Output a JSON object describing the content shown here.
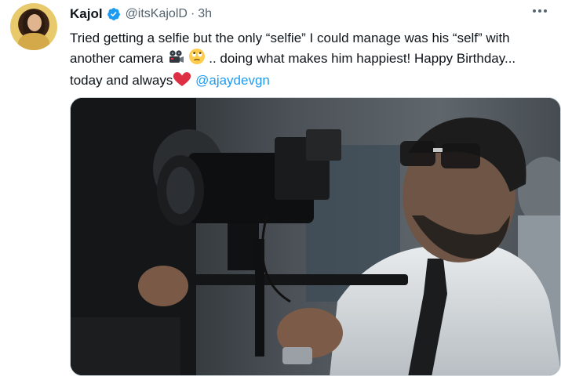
{
  "tweet": {
    "author": {
      "display_name": "Kajol",
      "handle": "@itsKajolD",
      "verified": true
    },
    "separator": "·",
    "time": "3h",
    "text": {
      "line1": "Tried getting a selfie but the only “selfie” I could manage was his “self” with",
      "line2a": "another camera ",
      "line2b": " .. doing what makes him happiest! Happy Birthday...",
      "line3a": "today and always",
      "mention": "@ajaydevgn"
    },
    "emojis": [
      "movie-camera-emoji",
      "eye-roll-emoji",
      "red-heart-emoji"
    ],
    "media": {
      "type": "photo",
      "subject": "man in glasses and white shirt operating a film camera rig"
    },
    "colors": {
      "link": "#1d9bf0",
      "verified": "#1d9bf0",
      "secondary_text": "#536471"
    }
  }
}
